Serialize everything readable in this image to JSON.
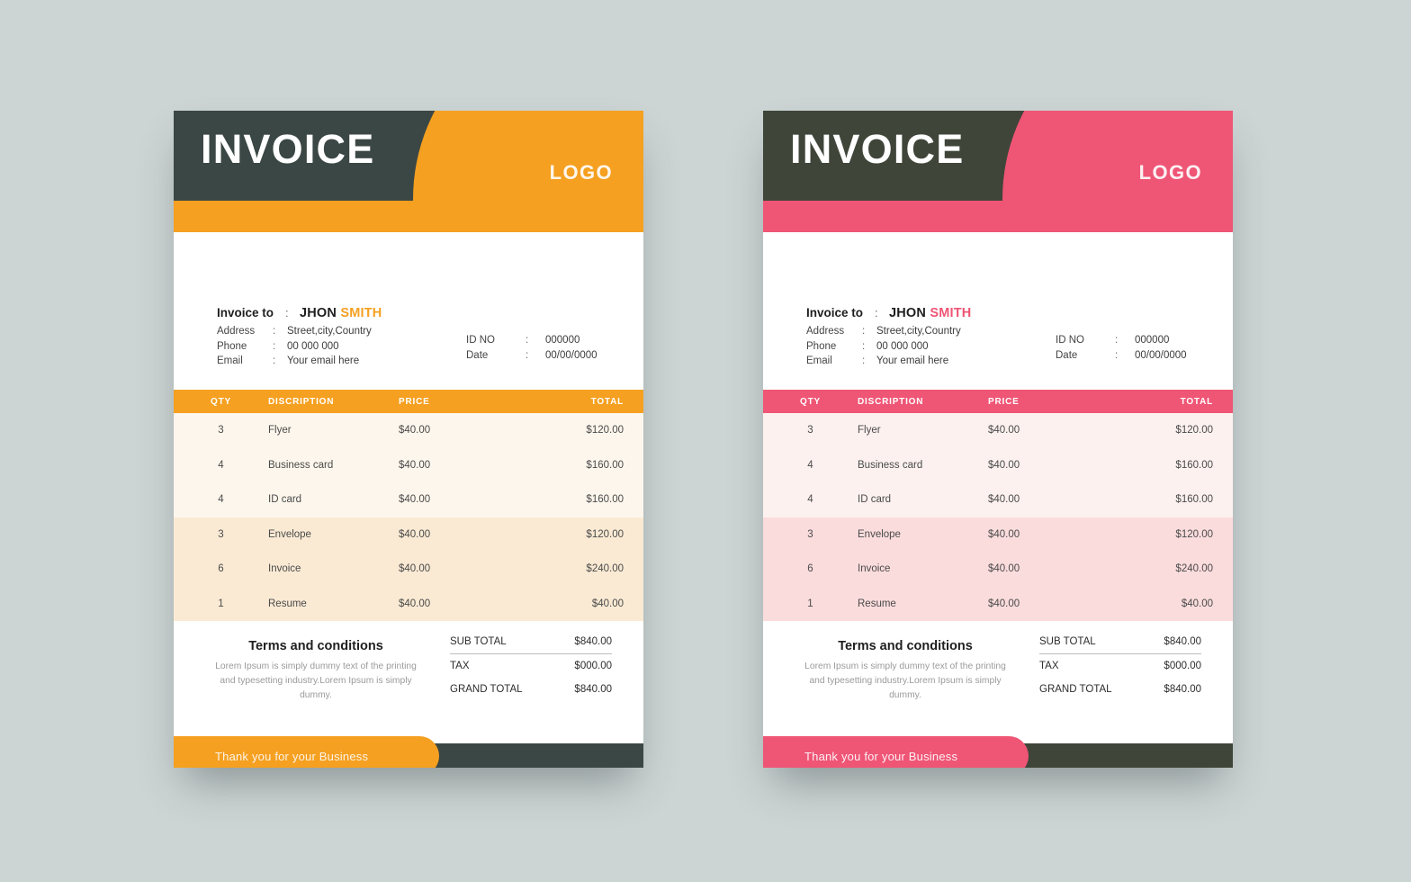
{
  "page": {
    "background_color": "#ccd4d4"
  },
  "templates": [
    {
      "variant": "orange",
      "accent_color": "#f5a020",
      "dark_color": "#3b4744",
      "row_band_a_color": "#fdf6ec",
      "row_band_b_color": "#faead4",
      "header": {
        "title": "INVOICE",
        "logo": "LOGO"
      },
      "bill_to": {
        "rows": [
          {
            "label": "Invoice to",
            "sep": ":",
            "value_first": "JHON",
            "value_accent": "SMITH"
          },
          {
            "label": "Address",
            "sep": ":",
            "value": "Street,city,Country"
          },
          {
            "label": "Phone",
            "sep": ":",
            "value": "00 000 000"
          },
          {
            "label": "Email",
            "sep": ":",
            "value": "Your email here"
          }
        ]
      },
      "meta": {
        "rows": [
          {
            "label": "ID NO",
            "sep": ":",
            "value": "000000"
          },
          {
            "label": "Date",
            "sep": ":",
            "value": "00/00/0000"
          }
        ]
      },
      "table": {
        "columns": [
          "QTY",
          "DISCRIPTION",
          "PRICE",
          "TOTAL"
        ],
        "band_a": [
          {
            "qty": "3",
            "desc": "Flyer",
            "price": "$40.00",
            "total": "$120.00"
          },
          {
            "qty": "4",
            "desc": "Business card",
            "price": "$40.00",
            "total": "$160.00"
          },
          {
            "qty": "4",
            "desc": "ID card",
            "price": "$40.00",
            "total": "$160.00"
          }
        ],
        "band_b": [
          {
            "qty": "3",
            "desc": "Envelope",
            "price": "$40.00",
            "total": "$120.00"
          },
          {
            "qty": "6",
            "desc": "Invoice",
            "price": "$40.00",
            "total": "$240.00"
          },
          {
            "qty": "1",
            "desc": "Resume",
            "price": "$40.00",
            "total": "$40.00"
          }
        ]
      },
      "terms": {
        "title": "Terms and conditions",
        "body": "Lorem Ipsum is simply dummy text of the printing and typesetting industry.Lorem Ipsum is simply dummy."
      },
      "summary": [
        {
          "label": "SUB TOTAL",
          "value": "$840.00"
        },
        {
          "label": "TAX",
          "value": "$000.00"
        },
        {
          "label": "GRAND TOTAL",
          "value": "$840.00"
        }
      ],
      "footer": {
        "text": "Thank you for your Business"
      }
    },
    {
      "variant": "pink",
      "accent_color": "#ef5575",
      "dark_color": "#3f4539",
      "row_band_a_color": "#fcf1ef",
      "row_band_b_color": "#fbdcdd",
      "header": {
        "title": "INVOICE",
        "logo": "LOGO"
      },
      "bill_to": {
        "rows": [
          {
            "label": "Invoice to",
            "sep": ":",
            "value_first": "JHON",
            "value_accent": "SMITH"
          },
          {
            "label": "Address",
            "sep": ":",
            "value": "Street,city,Country"
          },
          {
            "label": "Phone",
            "sep": ":",
            "value": "00 000 000"
          },
          {
            "label": "Email",
            "sep": ":",
            "value": "Your email here"
          }
        ]
      },
      "meta": {
        "rows": [
          {
            "label": "ID NO",
            "sep": ":",
            "value": "000000"
          },
          {
            "label": "Date",
            "sep": ":",
            "value": "00/00/0000"
          }
        ]
      },
      "table": {
        "columns": [
          "QTY",
          "DISCRIPTION",
          "PRICE",
          "TOTAL"
        ],
        "band_a": [
          {
            "qty": "3",
            "desc": "Flyer",
            "price": "$40.00",
            "total": "$120.00"
          },
          {
            "qty": "4",
            "desc": "Business card",
            "price": "$40.00",
            "total": "$160.00"
          },
          {
            "qty": "4",
            "desc": "ID card",
            "price": "$40.00",
            "total": "$160.00"
          }
        ],
        "band_b": [
          {
            "qty": "3",
            "desc": "Envelope",
            "price": "$40.00",
            "total": "$120.00"
          },
          {
            "qty": "6",
            "desc": "Invoice",
            "price": "$40.00",
            "total": "$240.00"
          },
          {
            "qty": "1",
            "desc": "Resume",
            "price": "$40.00",
            "total": "$40.00"
          }
        ]
      },
      "terms": {
        "title": "Terms and conditions",
        "body": "Lorem Ipsum is simply dummy text of the printing and typesetting industry.Lorem Ipsum is simply dummy."
      },
      "summary": [
        {
          "label": "SUB TOTAL",
          "value": "$840.00"
        },
        {
          "label": "TAX",
          "value": "$000.00"
        },
        {
          "label": "GRAND TOTAL",
          "value": "$840.00"
        }
      ],
      "footer": {
        "text": "Thank you for your Business"
      }
    }
  ]
}
